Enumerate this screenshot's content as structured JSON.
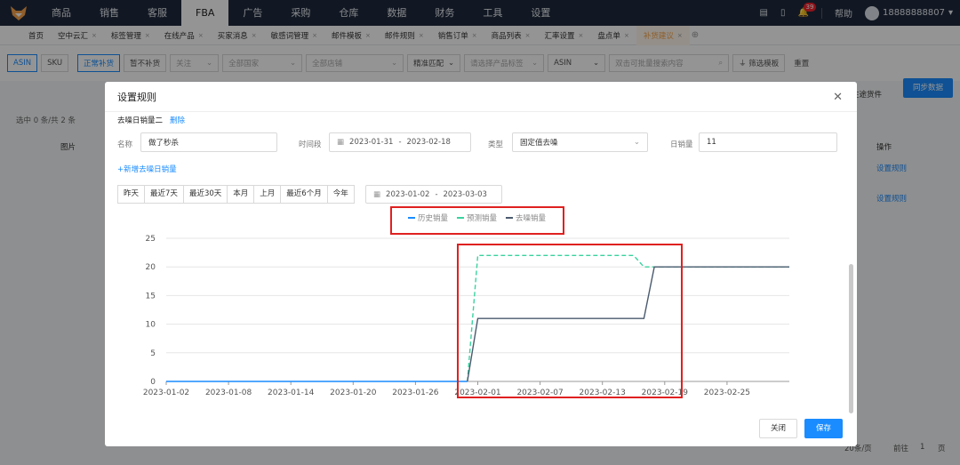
{
  "nav": {
    "items": [
      "商品",
      "销售",
      "客服",
      "FBA",
      "广告",
      "采购",
      "仓库",
      "数据",
      "财务",
      "工具",
      "设置"
    ],
    "active": "FBA",
    "help": "帮助",
    "user": "18888888807",
    "notif_count": "39"
  },
  "tabs": [
    "首页",
    "空中云汇",
    "标签管理",
    "在线产品",
    "买家消息",
    "敏感词管理",
    "邮件模板",
    "邮件规则",
    "销售订单",
    "商品列表",
    "汇率设置",
    "盘点单",
    "补货建议"
  ],
  "tabs_active": "补货建议",
  "filter": {
    "asin": "ASIN",
    "sku": "SKU",
    "normal": "正常补货",
    "pause": "暂不补货",
    "follow": "关注",
    "country": "全部国家",
    "shop": "全部店铺",
    "match": "精准匹配",
    "tag": "请选择产品标签",
    "asin2": "ASIN",
    "search": "双击可批量搜索内容",
    "template": "筛选模板",
    "reset": "重置",
    "transit": "在途货件",
    "sync": "同步数据"
  },
  "bg": {
    "selected": "选中 0 条/共 2 条",
    "col_img": "图片",
    "col_op": "操作",
    "op1": "设置规则",
    "op2": "设置规则",
    "pager_size": "20条/页",
    "goto": "前往",
    "page": "1",
    "page_unit": "页"
  },
  "dialog": {
    "title": "设置规则",
    "rule_name": "去噪日销量二",
    "delete": "删除",
    "name_label": "名称",
    "name_value": "做了秒杀",
    "period_label": "时间段",
    "period_start": "2023-01-31",
    "period_end": "2023-02-18",
    "type_label": "类型",
    "type_value": "固定值去噪",
    "daily_label": "日销量",
    "daily_value": "11",
    "add_link": "+新增去噪日销量",
    "quick": [
      "昨天",
      "最近7天",
      "最近30天",
      "本月",
      "上月",
      "最近6个月",
      "今年"
    ],
    "range_start": "2023-01-02",
    "range_end": "2023-03-03",
    "close": "关闭",
    "save": "保存"
  },
  "chart_data": {
    "type": "line",
    "x": [
      "2023-01-02",
      "2023-01-08",
      "2023-01-14",
      "2023-01-20",
      "2023-01-26",
      "2023-02-01",
      "2023-02-07",
      "2023-02-13",
      "2023-02-19",
      "2023-02-25"
    ],
    "xlim": [
      "2023-01-02",
      "2023-03-03"
    ],
    "ylim": [
      0,
      25
    ],
    "yticks": [
      0,
      5,
      10,
      15,
      20,
      25
    ],
    "legend_position": "top",
    "series": [
      {
        "name": "历史销量",
        "color": "#1a8cff",
        "style": "solid",
        "points": [
          [
            "2023-01-02",
            0
          ],
          [
            "2023-01-31",
            0
          ]
        ]
      },
      {
        "name": "预测销量",
        "color": "#3ad29f",
        "style": "dashed",
        "points": [
          [
            "2023-01-31",
            0
          ],
          [
            "2023-02-01",
            22
          ],
          [
            "2023-02-16",
            22
          ],
          [
            "2023-02-17",
            20
          ],
          [
            "2023-03-03",
            20
          ]
        ]
      },
      {
        "name": "去噪销量",
        "color": "#4a5a6e",
        "style": "solid",
        "points": [
          [
            "2023-01-31",
            0
          ],
          [
            "2023-02-01",
            11
          ],
          [
            "2023-02-17",
            11
          ],
          [
            "2023-02-18",
            20
          ],
          [
            "2023-03-03",
            20
          ]
        ]
      }
    ],
    "grid": true
  }
}
